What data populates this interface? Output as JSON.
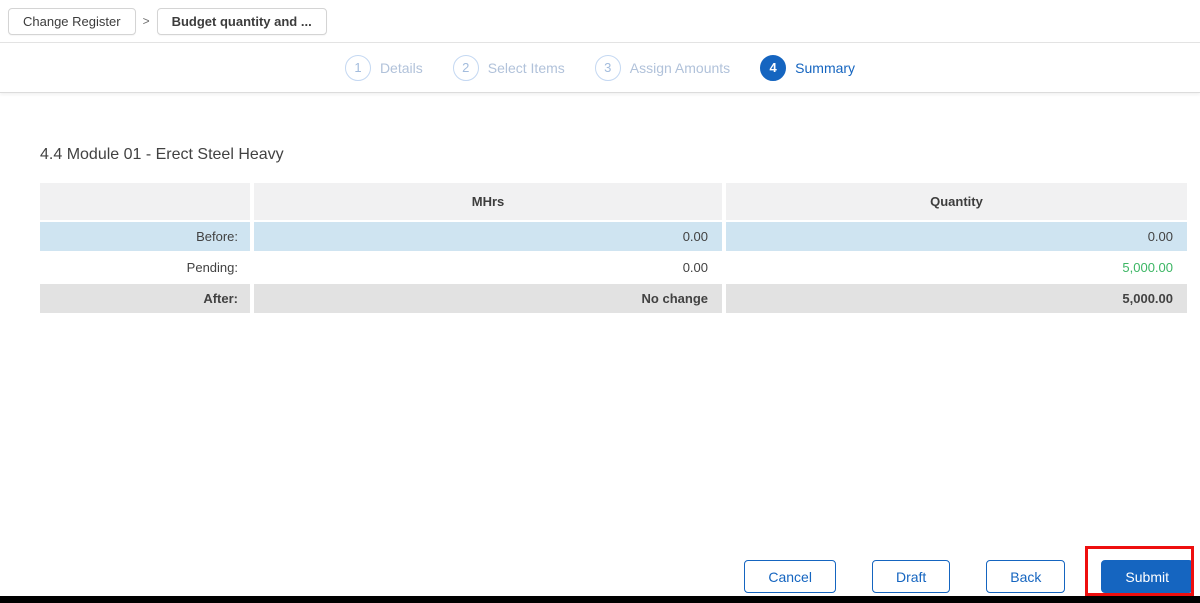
{
  "breadcrumb": {
    "separator": ">",
    "items": [
      {
        "label": "Change Register"
      },
      {
        "label": "Budget quantity and ..."
      }
    ]
  },
  "stepper": {
    "steps": [
      {
        "number": "1",
        "label": "Details",
        "active": false
      },
      {
        "number": "2",
        "label": "Select Items",
        "active": false
      },
      {
        "number": "3",
        "label": "Assign Amounts",
        "active": false
      },
      {
        "number": "4",
        "label": "Summary",
        "active": true
      }
    ]
  },
  "summary": {
    "section_title": "4.4 Module 01 - Erect Steel Heavy",
    "table": {
      "columns": [
        "",
        "MHrs",
        "Quantity"
      ],
      "rows": [
        {
          "label": "Before:",
          "mhrs": "0.00",
          "quantity": "0.00"
        },
        {
          "label": "Pending:",
          "mhrs": "0.00",
          "quantity": "5,000.00"
        },
        {
          "label": "After:",
          "mhrs": "No change",
          "quantity": "5,000.00"
        }
      ]
    }
  },
  "footer": {
    "buttons": [
      {
        "label": "Cancel",
        "variant": "outlined"
      },
      {
        "label": "Draft",
        "variant": "outlined"
      },
      {
        "label": "Back",
        "variant": "outlined"
      },
      {
        "label": "Submit",
        "variant": "filled",
        "annotated": true
      }
    ]
  },
  "colors": {
    "primary_blue": "#1565c0",
    "row_highlight_blue": "#cfe4f1",
    "row_highlight_gray": "#e2e2e2",
    "table_header_gray": "#f1f1f2",
    "pending_green": "#3cb664",
    "annotation_red": "#ee0f0f"
  }
}
